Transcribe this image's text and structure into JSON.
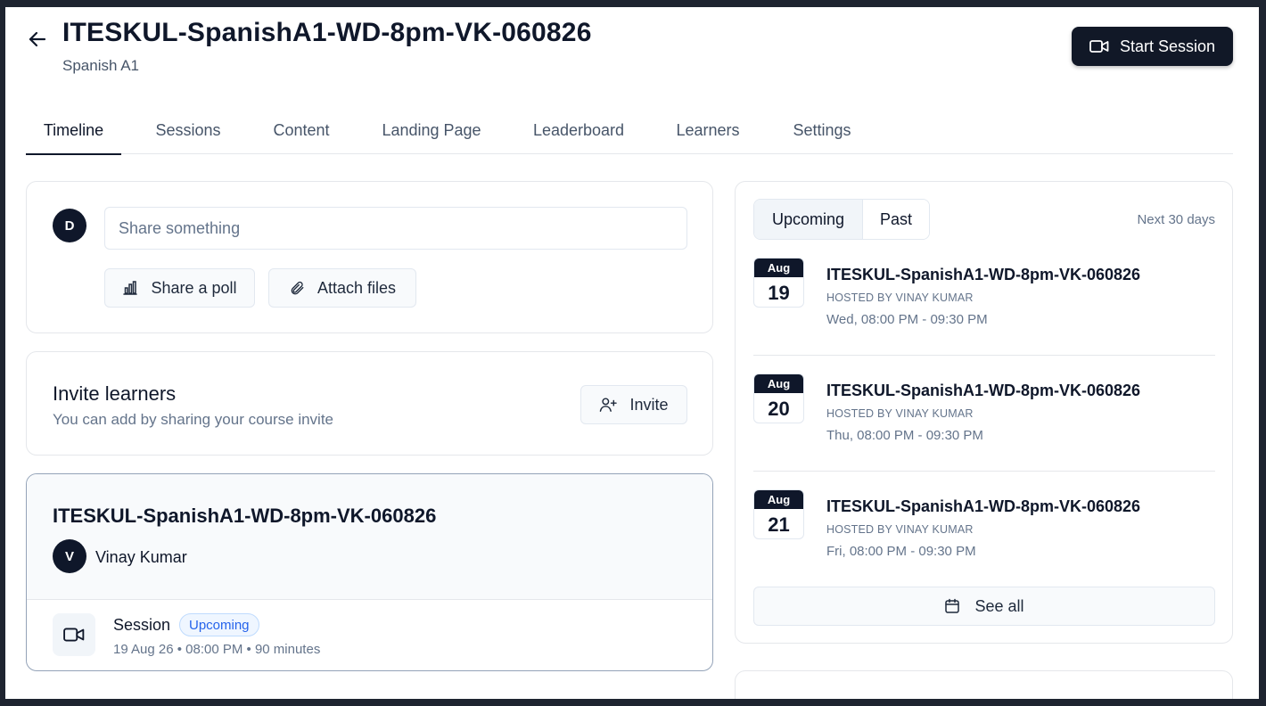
{
  "header": {
    "back_icon": "arrow-left-icon",
    "title": "ITESKUL-SpanishA1-WD-8pm-VK-060826",
    "subtitle": "Spanish A1",
    "start_session_label": "Start Session",
    "start_session_icon": "video-camera-icon"
  },
  "tabs": [
    {
      "label": "Timeline",
      "active": true
    },
    {
      "label": "Sessions"
    },
    {
      "label": "Content"
    },
    {
      "label": "Landing Page"
    },
    {
      "label": "Leaderboard"
    },
    {
      "label": "Learners"
    },
    {
      "label": "Settings"
    }
  ],
  "composer": {
    "avatar_initial": "D",
    "placeholder": "Share something",
    "poll_label": "Share a poll",
    "poll_icon": "bar-chart-icon",
    "attach_label": "Attach files",
    "attach_icon": "paperclip-icon"
  },
  "invite": {
    "title": "Invite learners",
    "subtitle": "You can add by sharing your course invite",
    "button_label": "Invite",
    "button_icon": "user-plus-icon"
  },
  "session_card": {
    "title": "ITESKUL-SpanishA1-WD-8pm-VK-060826",
    "host_initial": "V",
    "host_name": "Vinay Kumar",
    "type": "Session",
    "status": "Upcoming",
    "meta": "19 Aug 26 • 08:00 PM • 90 minutes"
  },
  "schedule": {
    "segments": [
      {
        "label": "Upcoming",
        "active": true
      },
      {
        "label": "Past"
      }
    ],
    "range_label": "Next 30 days",
    "events": [
      {
        "month": "Aug",
        "day": "19",
        "title": "ITESKUL-SpanishA1-WD-8pm-VK-060826",
        "host": "HOSTED BY VINAY KUMAR",
        "time": "Wed, 08:00 PM - 09:30 PM"
      },
      {
        "month": "Aug",
        "day": "20",
        "title": "ITESKUL-SpanishA1-WD-8pm-VK-060826",
        "host": "HOSTED BY VINAY KUMAR",
        "time": "Thu, 08:00 PM - 09:30 PM"
      },
      {
        "month": "Aug",
        "day": "21",
        "title": "ITESKUL-SpanishA1-WD-8pm-VK-060826",
        "host": "HOSTED BY VINAY KUMAR",
        "time": "Fri, 08:00 PM - 09:30 PM"
      }
    ],
    "see_all_label": "See all",
    "see_all_icon": "calendar-icon"
  },
  "colors": {
    "primary": "#111827",
    "badge_text": "#2563eb",
    "badge_bg": "#eff6ff",
    "muted_text": "#64748b"
  }
}
